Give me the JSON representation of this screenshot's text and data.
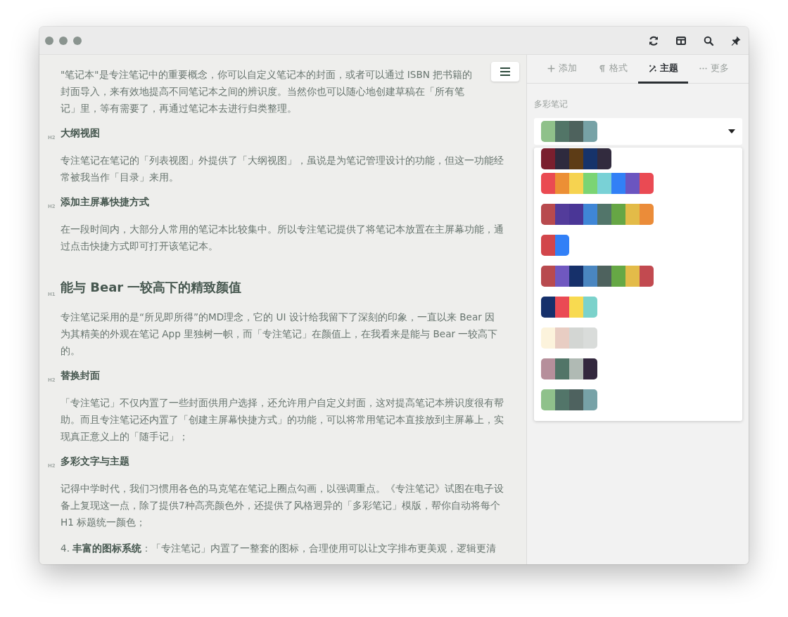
{
  "window": {
    "toolbar": [
      {
        "kind": "refresh"
      },
      {
        "kind": "columns"
      },
      {
        "kind": "search"
      },
      {
        "kind": "pin"
      }
    ]
  },
  "editor": {
    "blocks": [
      {
        "kind": "paragraph",
        "text": "\"笔记本\"是专注笔记中的重要概念，你可以自定义笔记本的封面，或者可以通过 ISBN 把书籍的封面导入，来有效地提高不同笔记本之间的辨识度。当然你也可以随心地创建草稿在「所有笔记」里，等有需要了，再通过笔记本去进行归类整理。"
      },
      {
        "kind": "h2",
        "marker": "H2",
        "text": "大纲视图"
      },
      {
        "kind": "paragraph",
        "text": "专注笔记在笔记的「列表视图」外提供了「大纲视图」，虽说是为笔记管理设计的功能，但这一功能经常被我当作「目录」来用。"
      },
      {
        "kind": "h2",
        "marker": "H2",
        "text": "添加主屏幕快捷方式"
      },
      {
        "kind": "paragraph",
        "text": "在一段时间内，大部分人常用的笔记本比较集中。所以专注笔记提供了将笔记本放置在主屏幕功能，通过点击快捷方式即可打开该笔记本。"
      },
      {
        "kind": "h1",
        "marker": "H1",
        "text": "能与 Bear 一较高下的精致颜值"
      },
      {
        "kind": "paragraph",
        "text": "专注笔记采用的是“所见即所得”的MD理念，它的 UI 设计给我留下了深刻的印象，一直以来 Bear 因为其精美的外观在笔记 App 里独树一帜，而「专注笔记」在颜值上，在我看来是能与 Bear 一较高下的。"
      },
      {
        "kind": "h2",
        "marker": "H2",
        "text": "替换封面"
      },
      {
        "kind": "paragraph",
        "text": "「专注笔记」不仅内置了一些封面供用户选择，还允许用户自定义封面，这对提高笔记本辨识度很有帮助。而且专注笔记还内置了「创建主屏幕快捷方式」的功能，可以将常用笔记本直接放到主屏幕上，实现真正意义上的「随手记」；"
      },
      {
        "kind": "h2",
        "marker": "H2",
        "text": "多彩文字与主题"
      },
      {
        "kind": "paragraph",
        "text": "记得中学时代，我们习惯用各色的马克笔在笔记上圈点勾画，以强调重点。《专注笔记》试图在电子设备上复现这一点，除了提供7种高亮颜色外，还提供了风格迥异的「多彩笔记」模版，帮你自动将每个 H1 标题统一颜色；"
      },
      {
        "kind": "list_item",
        "text": "4. **丰富的图标系统**：「专注笔记」内置了一整套的图标，合理使用可以让文字排布更美观，逻辑更清"
      }
    ]
  },
  "panel": {
    "tabs": [
      {
        "label": "添加",
        "selected": false
      },
      {
        "label": "格式",
        "selected": false
      },
      {
        "label": "主题",
        "selected": true
      },
      {
        "label": "更多",
        "selected": false
      }
    ],
    "section_label": "多彩笔记",
    "dropdown": {
      "expanded": true,
      "value": [
        {
          "color": "#8fc18a"
        },
        {
          "color": "#527567"
        },
        {
          "color": "#4e625d"
        },
        {
          "color": "#77a2a6"
        }
      ],
      "options": [
        {
          "swatches": [
            {
              "color": "#7a1f2e"
            },
            {
              "color": "#2e2a3e"
            },
            {
              "color": "#5d3c16"
            },
            {
              "color": "#16336a"
            },
            {
              "color": "#322b3e"
            }
          ]
        },
        {
          "swatches": [
            {
              "color": "#ea4a52"
            },
            {
              "color": "#ec8f35"
            },
            {
              "color": "#f6d350"
            },
            {
              "color": "#7bd474"
            },
            {
              "color": "#79d1d6"
            },
            {
              "color": "#3280f6"
            },
            {
              "color": "#6b55c0"
            },
            {
              "color": "#ea4a53"
            }
          ]
        },
        {
          "swatches": [
            {
              "color": "#b84a4e"
            },
            {
              "color": "#533c9b"
            },
            {
              "color": "#4a3696"
            },
            {
              "color": "#3f86d6"
            },
            {
              "color": "#52756a"
            },
            {
              "color": "#66a645"
            },
            {
              "color": "#e3bb48"
            },
            {
              "color": "#eb8c39"
            }
          ]
        },
        {
          "swatches": [
            {
              "color": "#d2464b"
            },
            {
              "color": "#3280f7"
            }
          ]
        },
        {
          "swatches": [
            {
              "color": "#b84a4f"
            },
            {
              "color": "#7058c0"
            },
            {
              "color": "#16306a"
            },
            {
              "color": "#4a86c0"
            },
            {
              "color": "#4e625e"
            },
            {
              "color": "#66a845"
            },
            {
              "color": "#e3bb49"
            },
            {
              "color": "#c24a50"
            }
          ]
        },
        {
          "swatches": [
            {
              "color": "#16306b"
            },
            {
              "color": "#ea4a54"
            },
            {
              "color": "#f8da50"
            },
            {
              "color": "#7bd2cb"
            }
          ]
        },
        {
          "swatches": [
            {
              "color": "#fcf3dc"
            },
            {
              "color": "#e8cdc3"
            },
            {
              "color": "#d3d6d3"
            },
            {
              "color": "#d9dcda"
            }
          ]
        },
        {
          "swatches": [
            {
              "color": "#b68f9b"
            },
            {
              "color": "#527568"
            },
            {
              "color": "#b0bab4"
            },
            {
              "color": "#33283e"
            }
          ]
        },
        {
          "swatches": [
            {
              "color": "#8fc18b"
            },
            {
              "color": "#527569"
            },
            {
              "color": "#4e625f"
            },
            {
              "color": "#77a2a7"
            }
          ]
        }
      ]
    }
  }
}
